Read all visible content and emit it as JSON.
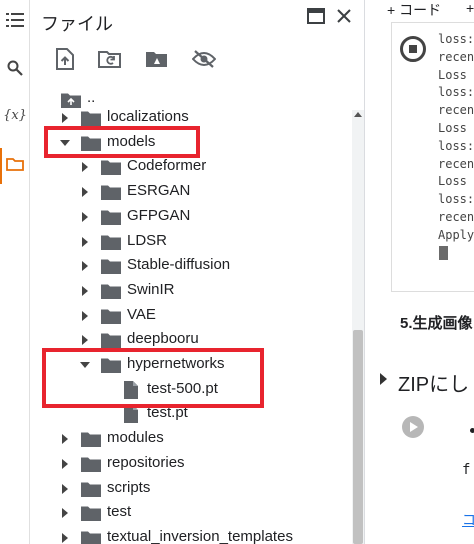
{
  "rail": {
    "items": [
      {
        "name": "toc-icon",
        "glyph": "☰"
      },
      {
        "name": "search-icon",
        "glyph": ""
      },
      {
        "name": "variables-icon",
        "glyph": "{x}"
      },
      {
        "name": "files-icon",
        "glyph": ""
      }
    ],
    "accent": "#e8710a"
  },
  "panel": {
    "title": "ファイル",
    "toolbar": [
      "upload-file-icon",
      "refresh-icon",
      "mount-drive-icon",
      "hide-files-icon"
    ]
  },
  "tree": {
    "parent": "..",
    "rows": [
      {
        "label": "localizations",
        "expanded": false,
        "type": "folder",
        "depth": 0
      },
      {
        "label": "models",
        "expanded": true,
        "type": "folder",
        "depth": 0
      },
      {
        "label": "Codeformer",
        "expanded": false,
        "type": "folder",
        "depth": 1
      },
      {
        "label": "ESRGAN",
        "expanded": false,
        "type": "folder",
        "depth": 1
      },
      {
        "label": "GFPGAN",
        "expanded": false,
        "type": "folder",
        "depth": 1
      },
      {
        "label": "LDSR",
        "expanded": false,
        "type": "folder",
        "depth": 1
      },
      {
        "label": "Stable-diffusion",
        "expanded": false,
        "type": "folder",
        "depth": 1
      },
      {
        "label": "SwinIR",
        "expanded": false,
        "type": "folder",
        "depth": 1
      },
      {
        "label": "VAE",
        "expanded": false,
        "type": "folder",
        "depth": 1
      },
      {
        "label": "deepbooru",
        "expanded": false,
        "type": "folder",
        "depth": 1
      },
      {
        "label": "hypernetworks",
        "expanded": true,
        "type": "folder",
        "depth": 1
      },
      {
        "label": "test-500.pt",
        "type": "file",
        "depth": 2
      },
      {
        "label": "test.pt",
        "type": "file",
        "depth": 2
      },
      {
        "label": "modules",
        "expanded": false,
        "type": "folder",
        "depth": 0
      },
      {
        "label": "repositories",
        "expanded": false,
        "type": "folder",
        "depth": 0
      },
      {
        "label": "scripts",
        "expanded": false,
        "type": "folder",
        "depth": 0
      },
      {
        "label": "test",
        "expanded": false,
        "type": "folder",
        "depth": 0
      },
      {
        "label": "textual_inversion_templates",
        "expanded": false,
        "type": "folder",
        "depth": 0
      }
    ]
  },
  "notebook": {
    "toolbar": {
      "code": "+ コード",
      "text": "+"
    },
    "output_lines": [
      "loss:",
      "recen",
      "Loss",
      "loss:",
      "recen",
      "Loss",
      "loss:",
      "recen",
      "Loss",
      "loss:",
      "recen",
      "Apply"
    ],
    "section_title": "5.生成画像",
    "zip_heading": "ZIPにし",
    "code_fragment": "f",
    "link_fragment": "コ"
  },
  "highlight_color": "#e8242e"
}
